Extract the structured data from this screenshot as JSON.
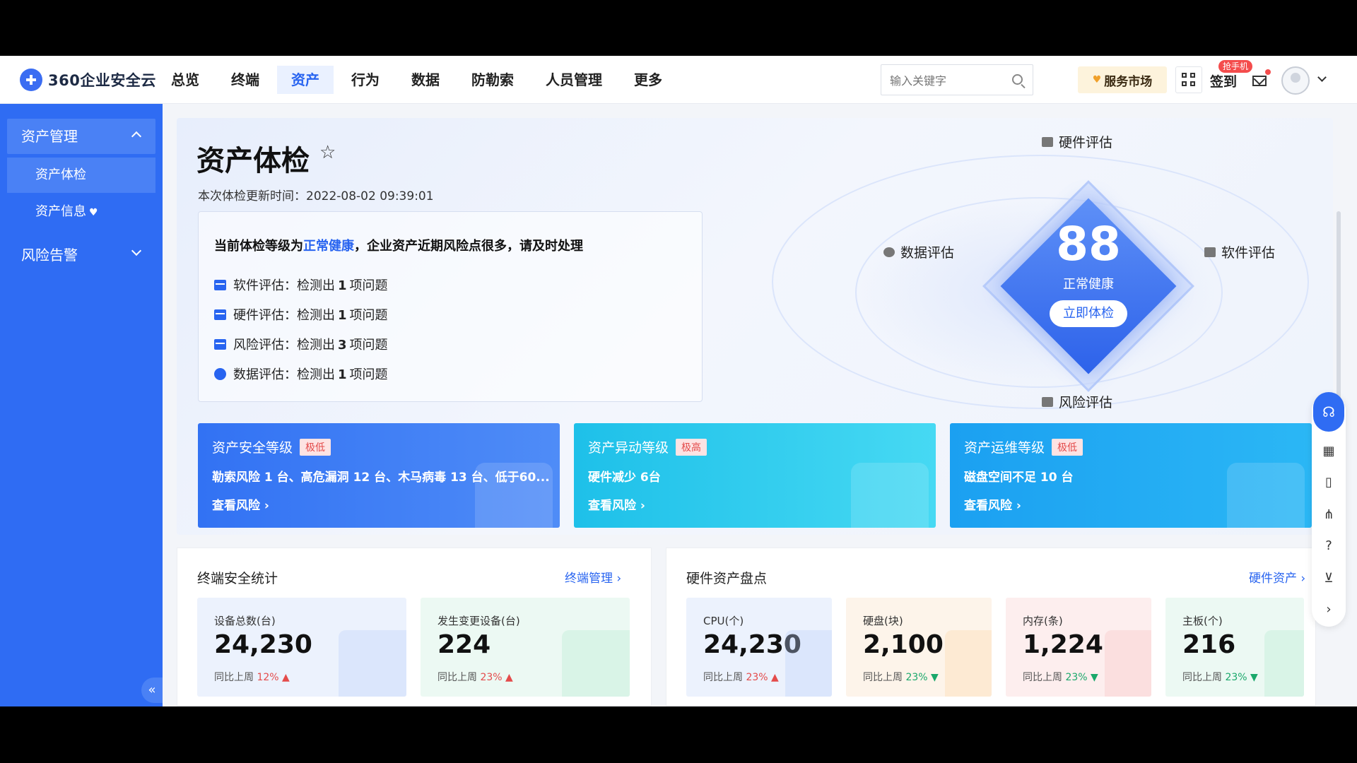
{
  "brand": {
    "name": "360企业安全云"
  },
  "nav": [
    "总览",
    "终端",
    "资产",
    "行为",
    "数据",
    "防勒索",
    "人员管理",
    "更多"
  ],
  "search": {
    "placeholder": "输入关键字"
  },
  "header": {
    "market": "服务市场",
    "signin": "签到",
    "phone_badge": "抢手机"
  },
  "sidebar": {
    "group1": "资产管理",
    "sub1": "资产体检",
    "sub2": "资产信息",
    "group2": "风险告警",
    "collapse": "«"
  },
  "page": {
    "title": "资产体检",
    "update_label": "本次体检更新时间：",
    "update_time": "2022-08-02 09:39:01"
  },
  "summary": {
    "prefix": "当前体检等级为",
    "level": "正常健康",
    "suffix": "，企业资产近期风险点很多，请及时处理",
    "issues": [
      {
        "label": "软件评估：检测出",
        "count": "1",
        "unit": "项问题"
      },
      {
        "label": "硬件评估：检测出",
        "count": "1",
        "unit": "项问题"
      },
      {
        "label": "风险评估：检测出",
        "count": "3",
        "unit": "项问题"
      },
      {
        "label": "数据评估：检测出",
        "count": "1",
        "unit": "项问题"
      }
    ]
  },
  "score": {
    "value": "88",
    "status": "正常健康",
    "button": "立即体检",
    "top": "硬件评估",
    "left": "数据评估",
    "right": "软件评估",
    "bottom": "风险评估"
  },
  "levels": [
    {
      "title": "资产安全等级",
      "tag": "极低",
      "desc": "勒索风险 1 台、高危漏洞 12 台、木马病毒 13 台、低于60...",
      "link": "查看风险 ›",
      "color": "#3476f4"
    },
    {
      "title": "资产异动等级",
      "tag": "极高",
      "desc": "硬件减少 6台",
      "link": "查看风险 ›",
      "color": "#22c4ea"
    },
    {
      "title": "资产运维等级",
      "tag": "极低",
      "desc": "磁盘空间不足 10 台",
      "link": "查看风险 ›",
      "color": "#1ea9f2"
    }
  ],
  "terminal": {
    "title": "终端安全统计",
    "link": "终端管理 ›",
    "cards": [
      {
        "label": "设备总数(台)",
        "value": "24,230",
        "cmp": "同比上周",
        "pct": "12%",
        "trend": "▲"
      },
      {
        "label": "发生变更设备(台)",
        "value": "224",
        "cmp": "同比上周",
        "pct": "23%",
        "trend": "▲"
      }
    ]
  },
  "hardware": {
    "title": "硬件资产盘点",
    "link": "硬件资产 ›",
    "cards": [
      {
        "label": "CPU(个)",
        "value": "24,230",
        "cmp": "同比上周",
        "pct": "23%",
        "trend": "▲"
      },
      {
        "label": "硬盘(块)",
        "value": "2,100",
        "cmp": "同比上周",
        "pct": "23%",
        "trend": "▼"
      },
      {
        "label": "内存(条)",
        "value": "1,224",
        "cmp": "同比上周",
        "pct": "23%",
        "trend": "▼"
      },
      {
        "label": "主板(个)",
        "value": "216",
        "cmp": "同比上周",
        "pct": "23%",
        "trend": "▼"
      }
    ]
  },
  "float_bar": [
    "headset-icon",
    "qrcode-icon",
    "phone-icon",
    "org-icon",
    "help-icon",
    "cart-icon",
    "chevron-right-icon"
  ]
}
